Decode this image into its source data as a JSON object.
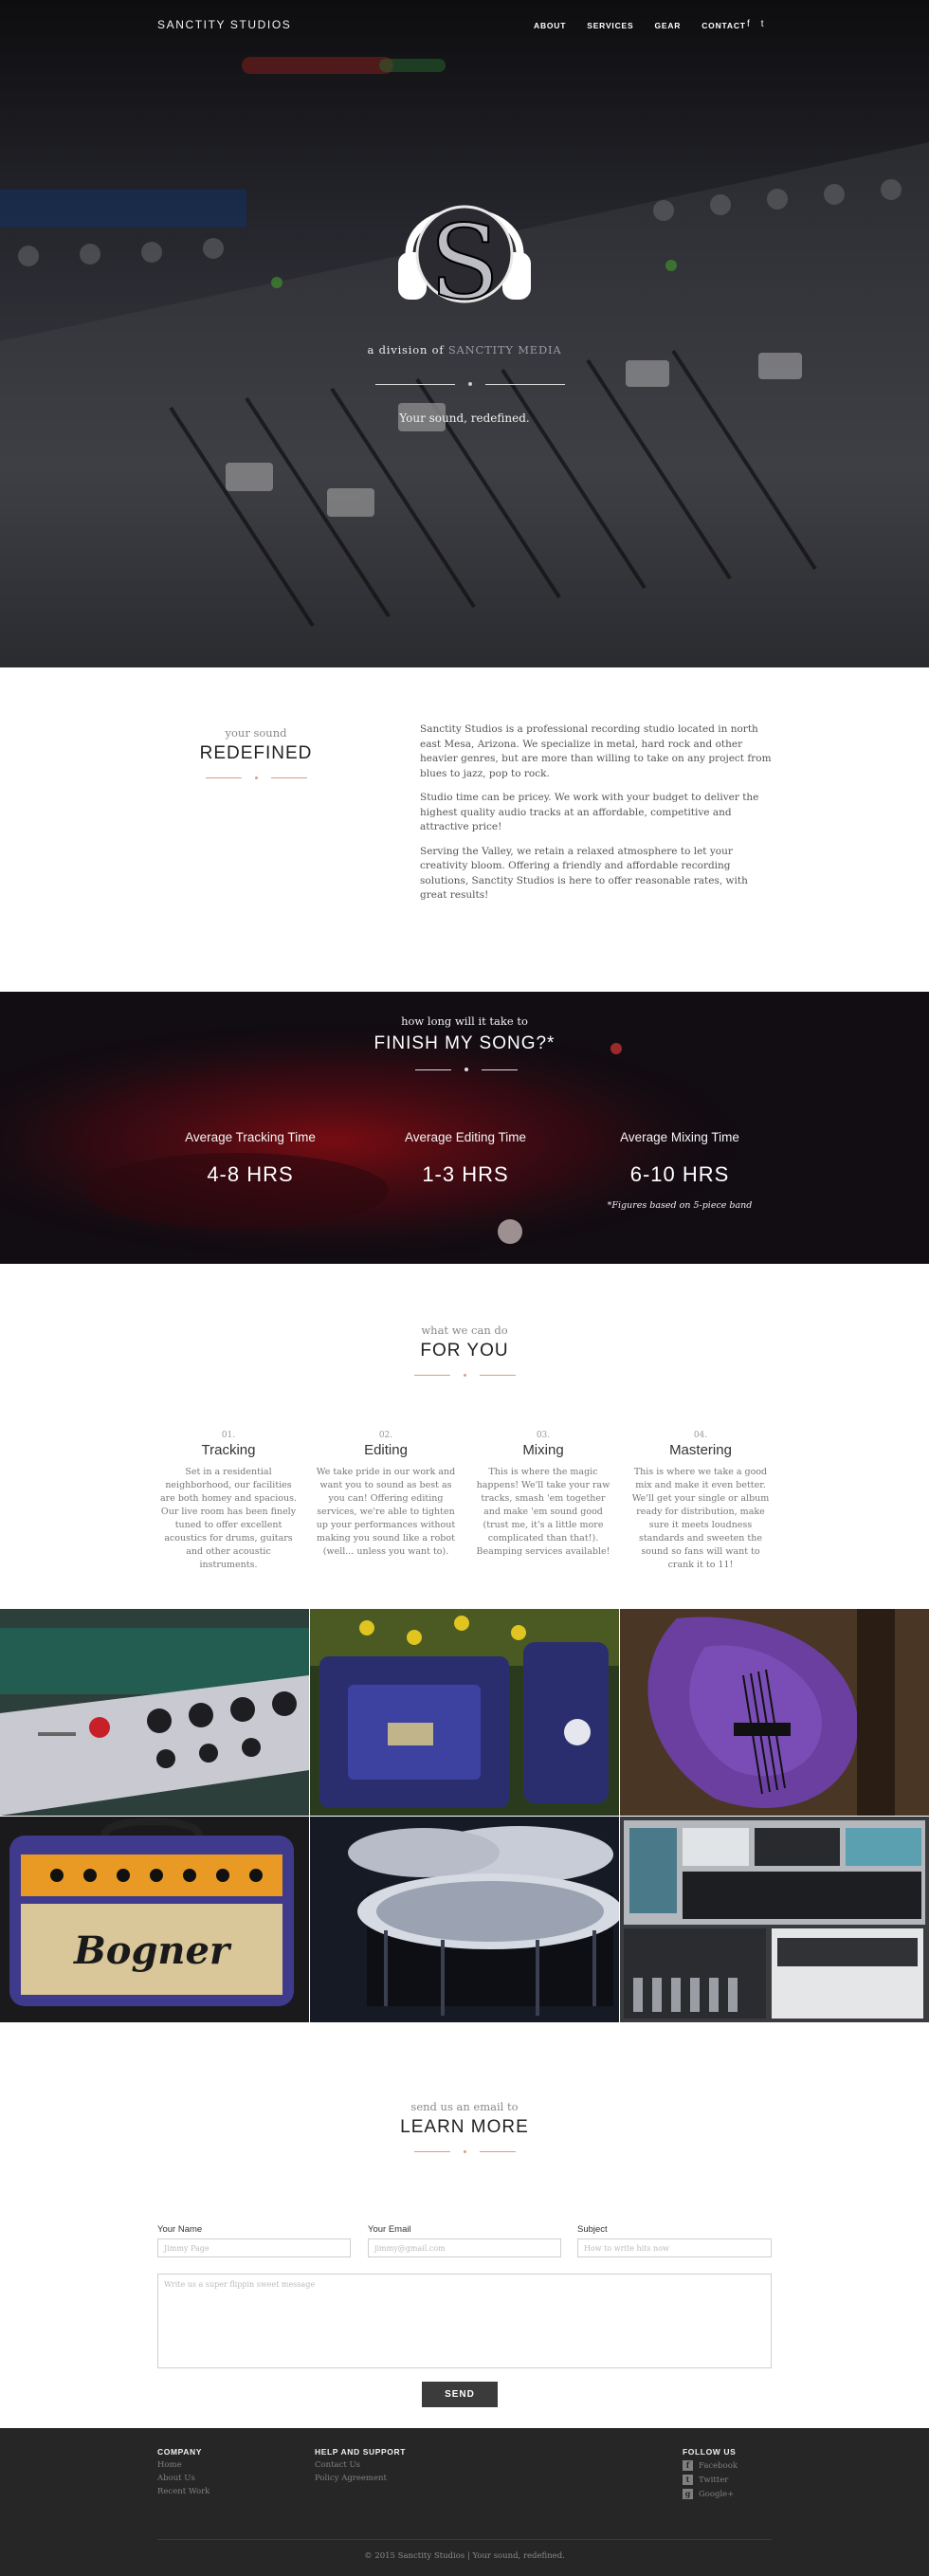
{
  "nav": {
    "brand": "SANCTITY STUDIOS",
    "links": [
      "ABOUT",
      "SERVICES",
      "GEAR",
      "CONTACT"
    ],
    "social": [
      {
        "icon": "facebook-icon",
        "glyph": "f"
      },
      {
        "icon": "twitter-icon",
        "glyph": "t"
      }
    ]
  },
  "hero": {
    "logo_letter": "S",
    "division_prefix": "a division of ",
    "division_name": "SANCTITY MEDIA",
    "tagline": "Your sound, redefined."
  },
  "about": {
    "over": "your sound",
    "heading": "REDEFINED",
    "paragraphs": [
      "Sanctity Studios is a professional recording studio located in north east Mesa, Arizona. We specialize in metal, hard rock and other heavier genres, but are more than willing to take on any project from blues to jazz, pop to rock.",
      "Studio time can be pricey. We work with your budget to deliver the highest quality audio tracks at an affordable, competitive and attractive price!",
      "Serving the Valley, we retain a relaxed atmosphere to let your creativity bloom. Offering a friendly and affordable recording solutions, Sanctity Studios is here to offer reasonable rates, with great results!"
    ]
  },
  "finish": {
    "over": "how long will it take to",
    "heading": "FINISH MY SONG?*",
    "stats": [
      {
        "label": "Average Tracking Time",
        "value": "4-8 HRS"
      },
      {
        "label": "Average Editing Time",
        "value": "1-3 HRS"
      },
      {
        "label": "Average Mixing Time",
        "value": "6-10 HRS"
      }
    ],
    "note": "*Figures based on 5-piece band"
  },
  "services": {
    "over": "what we can do",
    "heading": "FOR YOU",
    "items": [
      {
        "num": "01.",
        "title": "Tracking",
        "desc": "Set in a residential neighborhood, our facilities are both homey and spacious. Our live room has been finely tuned to offer excellent acoustics for drums, guitars and other acoustic instruments."
      },
      {
        "num": "02.",
        "title": "Editing",
        "desc": "We take pride in our work and want you to sound as best as you can! Offering editing services, we're able to tighten up your performances without making you sound like a robot (well... unless you want to)."
      },
      {
        "num": "03.",
        "title": "Mixing",
        "desc": "This is where the magic happens! We'll take your raw tracks, smash 'em together and make 'em sound good (trust me, it's a little more complicated than that!). Beamping services available!"
      },
      {
        "num": "04.",
        "title": "Mastering",
        "desc": "This is where we take a good mix and make it even better. We'll get your single or album ready for distribution, make sure it meets loudness standards and sweeten the sound so fans will want to crank it to 11!"
      }
    ]
  },
  "gallery": {
    "amp_brand": "Bogner"
  },
  "contact": {
    "over": "send us an email to",
    "heading": "LEARN MORE",
    "name_label": "Your Name",
    "name_placeholder": "Jimmy Page",
    "email_label": "Your Email",
    "email_placeholder": "jimmy@gmail.com",
    "subject_label": "Subject",
    "subject_placeholder": "How to write hits now",
    "message_placeholder": "Write us a super flippin sweet message",
    "send": "SEND"
  },
  "footer": {
    "company_head": "COMPANY",
    "company_links": [
      "Home",
      "About Us",
      "Recent Work"
    ],
    "help_head": "HELP AND SUPPORT",
    "help_links": [
      "Contact Us",
      "Policy Agreement"
    ],
    "follow_head": "FOLLOW US",
    "follow_links": [
      {
        "icon": "facebook-icon",
        "glyph": "f",
        "label": "Facebook"
      },
      {
        "icon": "twitter-icon",
        "glyph": "t",
        "label": "Twitter"
      },
      {
        "icon": "google-plus-icon",
        "glyph": "g",
        "label": "Google+"
      }
    ],
    "copyright": "© 2015 Sanctity Studios  |  Your sound, redefined."
  },
  "colors": {
    "accent": "#d4a088",
    "dark": "#262626",
    "button": "#3b3b3b"
  }
}
